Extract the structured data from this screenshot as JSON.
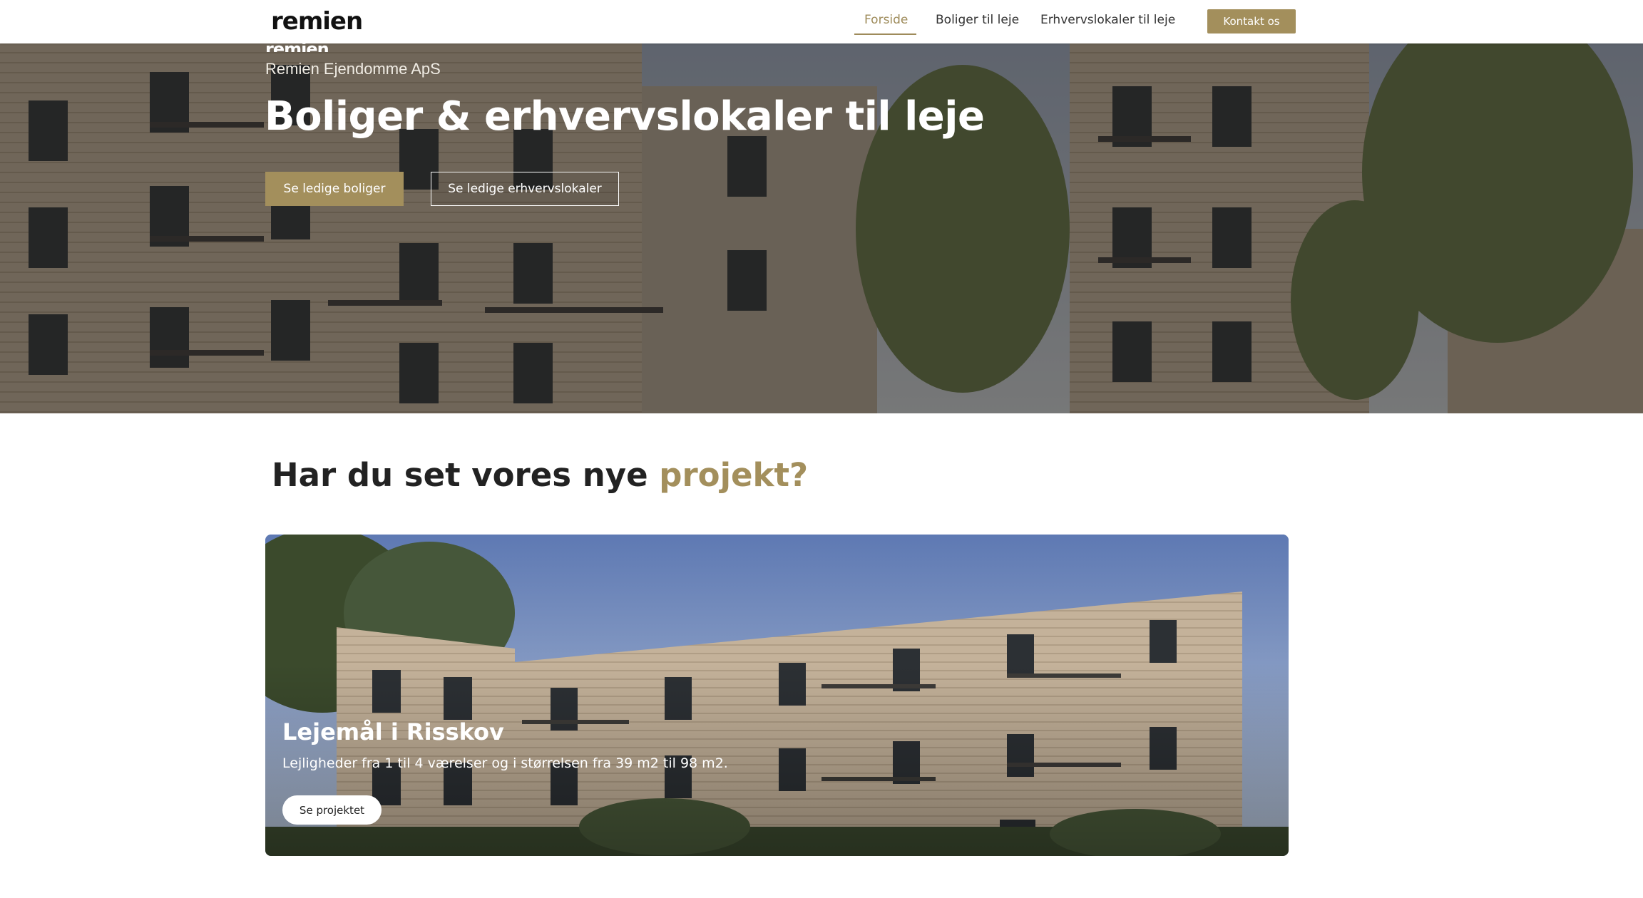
{
  "header": {
    "logo": "remien",
    "nav": [
      {
        "label": "Forside",
        "active": true
      },
      {
        "label": "Boliger til leje",
        "active": false
      },
      {
        "label": "Erhvervslokaler til leje",
        "active": false
      }
    ],
    "contact_label": "Kontakt os"
  },
  "hero": {
    "logo_small": "remien",
    "company": "Remien Ejendomme ApS",
    "title": "Boliger & erhvervslokaler til leje",
    "primary_button": "Se ledige boliger",
    "secondary_button": "Se ledige erhvervslokaler"
  },
  "section": {
    "title_main": "Har du set vores nye ",
    "title_accent": "projekt?"
  },
  "project": {
    "title": "Lejemål i Risskov",
    "description": "Lejligheder fra 1 til 4 værelser og i størrelsen fra 39 m2 til 98 m2.",
    "button": "Se projektet"
  },
  "colors": {
    "accent": "#a38f5c",
    "text": "#222222",
    "background": "#ffffff"
  }
}
